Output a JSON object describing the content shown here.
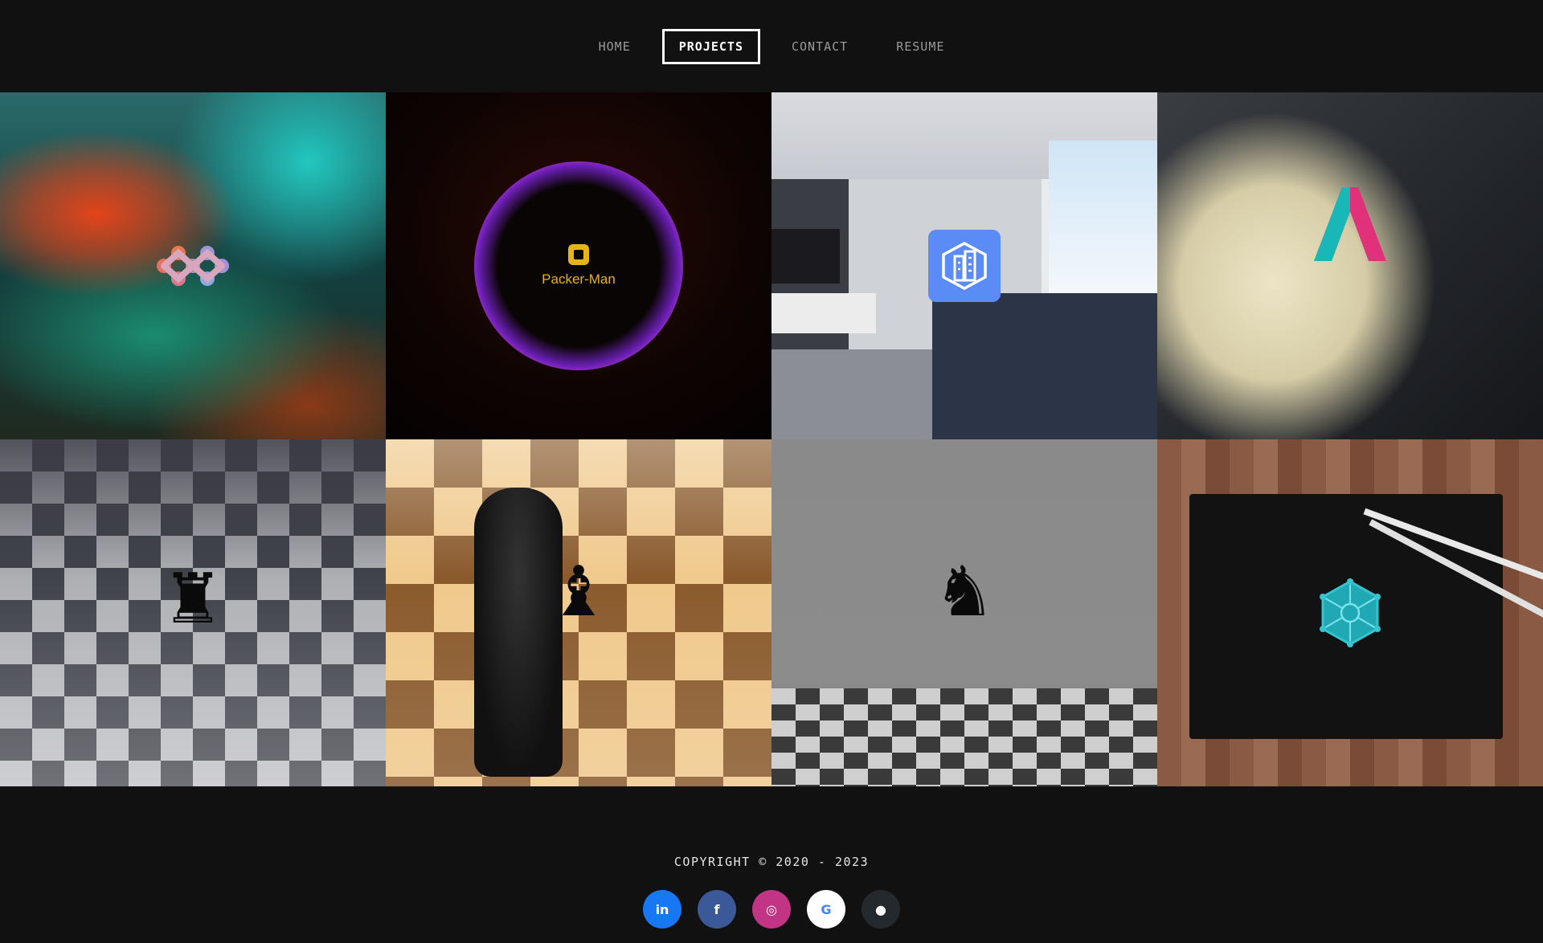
{
  "nav": {
    "items": [
      {
        "label": "HOME",
        "active": false
      },
      {
        "label": "PROJECTS",
        "active": true
      },
      {
        "label": "CONTACT",
        "active": false
      },
      {
        "label": "RESUME",
        "active": false
      }
    ]
  },
  "projects": [
    {
      "logo": "dots-network-logo-icon",
      "background": "abstract-colorful-bokeh"
    },
    {
      "logo_text": "Packer-Man",
      "logo": "packer-man-bubble-logo",
      "background": "soap-bubble-dark"
    },
    {
      "logo": "building-app-icon",
      "background": "living-room"
    },
    {
      "logo": "a-letter-logo-icon",
      "background": "open-notebook"
    },
    {
      "logo": "chess-rook-icon",
      "background": "chess-board-pieces"
    },
    {
      "logo": "chess-queen-icon",
      "background": "wooden-chess-board"
    },
    {
      "logo": "chess-knight-icon",
      "background": "grey-chess-board"
    },
    {
      "logo": "hexagon-network-logo-icon",
      "background": "notepad-on-wood"
    }
  ],
  "footer": {
    "copyright": "COPYRIGHT © 2020 - 2023"
  },
  "social": [
    {
      "name": "linkedin-icon",
      "glyph": "in",
      "color": "#1877f2"
    },
    {
      "name": "facebook-icon",
      "glyph": "f",
      "color": "#3b5998"
    },
    {
      "name": "instagram-icon",
      "glyph": "◎",
      "color": "#c13584"
    },
    {
      "name": "google-icon",
      "glyph": "G",
      "color": "#ffffff"
    },
    {
      "name": "github-icon",
      "glyph": "●",
      "color": "#24292e"
    }
  ],
  "colors": {
    "background": "#111111",
    "nav_text": "#9a9a9a",
    "nav_active": "#ffffff",
    "packer_man": "#e6b31a",
    "app_icon": "#5b8cf5",
    "teal": "#19b7b7",
    "pink": "#e0317a"
  }
}
